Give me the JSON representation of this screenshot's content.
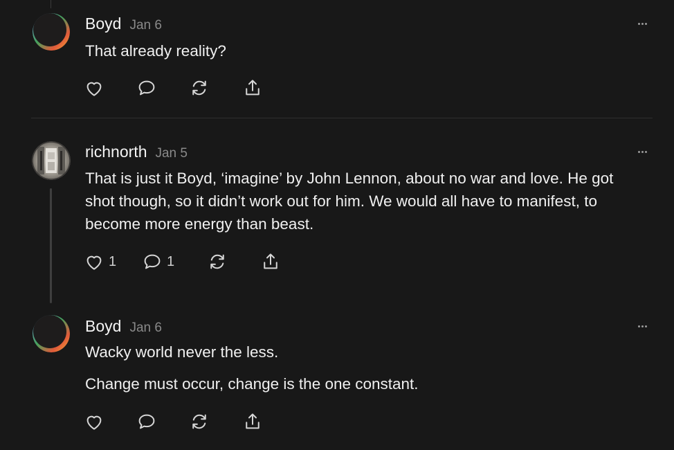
{
  "comments": [
    {
      "author": "Boyd",
      "date": "Jan 6",
      "body": [
        "That already reality?"
      ],
      "likes": "",
      "replies": ""
    },
    {
      "author": "richnorth",
      "date": "Jan 5",
      "body": [
        "That is just it Boyd, ‘imagine’ by John Lennon, about no war and love. He got shot though, so it didn’t work out for him. We would all have to manifest, to become more energy than beast."
      ],
      "likes": "1",
      "replies": "1"
    },
    {
      "author": "Boyd",
      "date": "Jan 6",
      "body": [
        "Wacky world never the less.",
        "Change must occur, change is the one constant."
      ],
      "likes": "",
      "replies": ""
    }
  ],
  "colors": {
    "background": "#181818",
    "text": "#f0f0f0",
    "muted": "#8a8a8a",
    "divider": "#2f2f2f"
  },
  "icons": [
    "heart-icon",
    "comment-icon",
    "restack-icon",
    "share-icon",
    "more-icon"
  ]
}
